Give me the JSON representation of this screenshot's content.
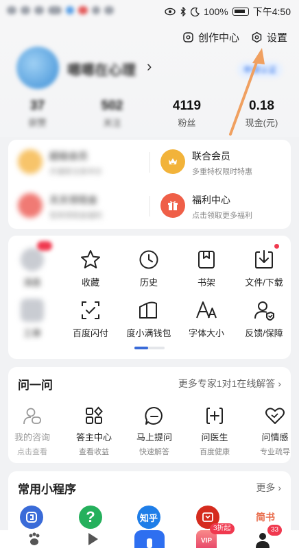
{
  "status_bar": {
    "battery": "100%",
    "time": "下午4:50"
  },
  "header": {
    "creator_center": "创作中心",
    "settings": "设置",
    "username": "嗯嗯在心理",
    "verify_button": "申请认证",
    "stats": [
      {
        "value": "37",
        "label": "获赞"
      },
      {
        "value": "502",
        "label": "关注"
      },
      {
        "value": "4119",
        "label": "粉丝"
      },
      {
        "value": "0.18",
        "label": "现金(元)"
      }
    ]
  },
  "member_card": {
    "items": [
      {
        "title": "超级会员",
        "subtitle": "开通享文库半价"
      },
      {
        "title": "联合会员",
        "subtitle": "多重特权限时特惠"
      },
      {
        "title": "天天领现金",
        "subtitle": "签到领现金福利"
      },
      {
        "title": "福利中心",
        "subtitle": "点击领取更多福利"
      }
    ]
  },
  "tools": {
    "row1": [
      {
        "label": "消息",
        "icon": "message-icon"
      },
      {
        "label": "收藏",
        "icon": "star-icon"
      },
      {
        "label": "历史",
        "icon": "clock-icon"
      },
      {
        "label": "书架",
        "icon": "bookshelf-icon"
      },
      {
        "label": "文件/下载",
        "icon": "download-icon"
      }
    ],
    "row2": [
      {
        "label": "工单",
        "icon": "ticket-icon"
      },
      {
        "label": "百度闪付",
        "icon": "scan-pay-icon"
      },
      {
        "label": "度小满钱包",
        "icon": "wallet-icon"
      },
      {
        "label": "字体大小",
        "icon": "font-size-icon"
      },
      {
        "label": "反馈/保障",
        "icon": "feedback-icon"
      }
    ]
  },
  "ask": {
    "title": "问一问",
    "more": "更多专家1对1在线解答",
    "items": [
      {
        "title": "我的咨询",
        "subtitle": "点击查看"
      },
      {
        "title": "答主中心",
        "subtitle": "查看收益"
      },
      {
        "title": "马上提问",
        "subtitle": "快速解答"
      },
      {
        "title": "问医生",
        "subtitle": "百度健康"
      },
      {
        "title": "问情感",
        "subtitle": "专业疏导"
      }
    ]
  },
  "mini_apps": {
    "title": "常用小程序",
    "more": "更多",
    "zhihu": "知乎",
    "jianshu": "简书"
  },
  "bottom_nav": {
    "vip_badge": "3折起",
    "vip_label": "VIP",
    "profile_badge": "33"
  },
  "colors": {
    "accent": "#2c6fea",
    "orange_arrow": "#f0a060",
    "red_dot": "#f0394f"
  }
}
